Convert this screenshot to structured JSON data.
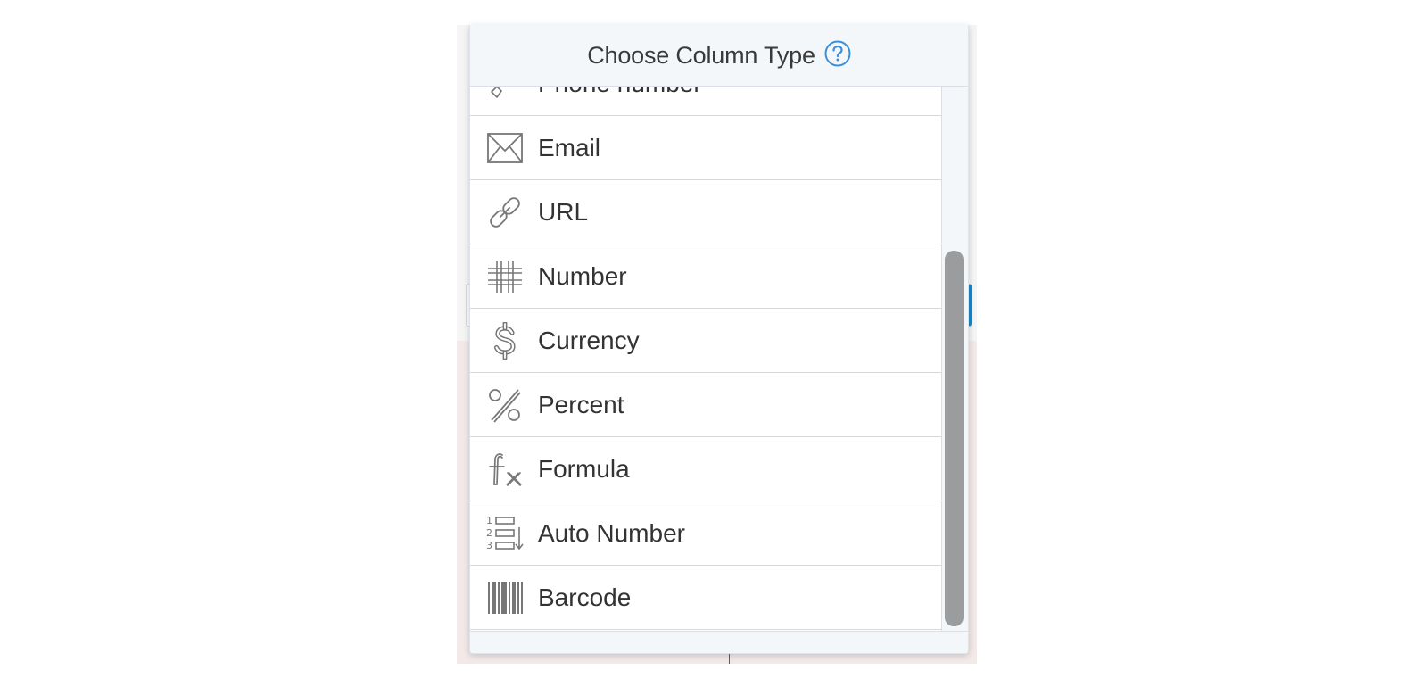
{
  "dialog": {
    "title": "Choose Column Type",
    "help_icon": "question-circle-icon",
    "accent_color": "#3b8fd9"
  },
  "column_types": [
    {
      "label": "Phone number",
      "icon": "phone-icon"
    },
    {
      "label": "Email",
      "icon": "envelope-icon"
    },
    {
      "label": "URL",
      "icon": "link-icon"
    },
    {
      "label": "Number",
      "icon": "hash-icon"
    },
    {
      "label": "Currency",
      "icon": "dollar-icon"
    },
    {
      "label": "Percent",
      "icon": "percent-icon"
    },
    {
      "label": "Formula",
      "icon": "formula-icon"
    },
    {
      "label": "Auto Number",
      "icon": "auto-number-icon"
    },
    {
      "label": "Barcode",
      "icon": "barcode-icon"
    }
  ]
}
